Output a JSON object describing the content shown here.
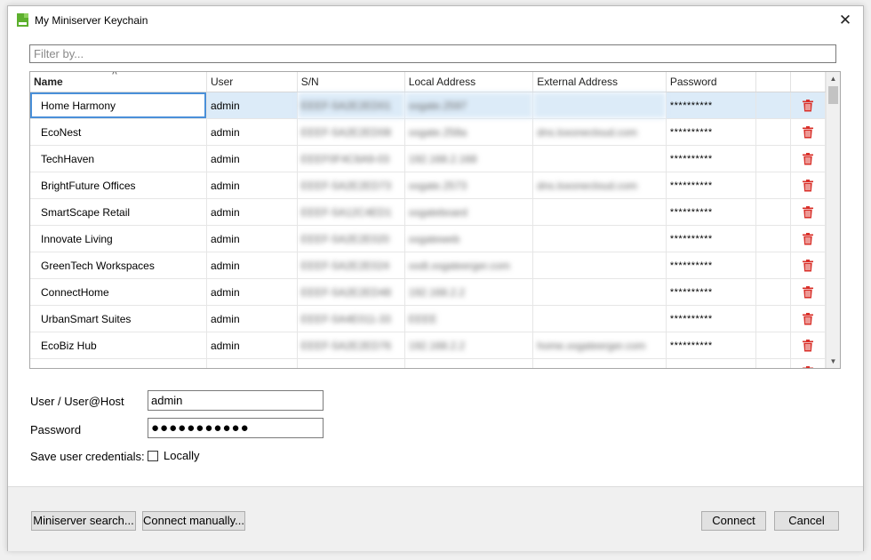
{
  "window": {
    "title": "My Miniserver Keychain",
    "close_glyph": "✕"
  },
  "filter": {
    "placeholder": "Filter by...",
    "value": ""
  },
  "table": {
    "columns": [
      "Name",
      "User",
      "S/N",
      "Local Address",
      "External Address",
      "Password"
    ],
    "rows": [
      {
        "name": "Home Harmony",
        "user": "admin",
        "sn": "EEEF-5A2E2ED01",
        "local": "xxgate.2597",
        "external": "",
        "password": "**********"
      },
      {
        "name": "EcoNest",
        "user": "admin",
        "sn": "EEEF-5A2E2ED08",
        "local": "xxgate.258a",
        "external": "dns.loxonecloud.com",
        "password": "**********"
      },
      {
        "name": "TechHaven",
        "user": "admin",
        "sn": "EEEF0F4C6A9-03",
        "local": "192.168.2.168",
        "external": "",
        "password": "**********"
      },
      {
        "name": "BrightFuture Offices",
        "user": "admin",
        "sn": "EEEF-5A2E2ED73",
        "local": "xxgate.2573",
        "external": "dns.loxonecloud.com",
        "password": "**********"
      },
      {
        "name": "SmartScape Retail",
        "user": "admin",
        "sn": "EEEF-5A12C4ED1",
        "local": "xxgateboard",
        "external": "",
        "password": "**********"
      },
      {
        "name": "Innovate Living",
        "user": "admin",
        "sn": "EEEF-5A2E2E020",
        "local": "xxgateweb",
        "external": "",
        "password": "**********"
      },
      {
        "name": "GreenTech Workspaces",
        "user": "admin",
        "sn": "EEEF-5A2E2E024",
        "local": "xxdt.xxgateerger.com",
        "external": "",
        "password": "**********"
      },
      {
        "name": "ConnectHome",
        "user": "admin",
        "sn": "EEEF-5A2E2ED48",
        "local": "192.168.2.2",
        "external": "",
        "password": "**********"
      },
      {
        "name": "UrbanSmart Suites",
        "user": "admin",
        "sn": "EEEF-5A4E011-33",
        "local": "EEEE",
        "external": "",
        "password": "**********"
      },
      {
        "name": "EcoBiz Hub",
        "user": "admin",
        "sn": "EEEF-5A2E2ED76",
        "local": "192.168.2.2",
        "external": "home.xxgateerger.com",
        "password": "**********"
      }
    ]
  },
  "form": {
    "user_label": "User / User@Host",
    "user_value": "admin",
    "password_label": "Password",
    "password_value": "●●●●●●●●●●●",
    "save_label": "Save user credentials:",
    "locally_label": "Locally",
    "locally_checked": false
  },
  "buttons": {
    "search": "Miniserver search...",
    "manual": "Connect manually...",
    "connect": "Connect",
    "cancel": "Cancel"
  },
  "colors": {
    "selection": "#dcebf8",
    "focus": "#4a90d9",
    "delete": "#d9302a",
    "app_icon": "#5db02e"
  }
}
